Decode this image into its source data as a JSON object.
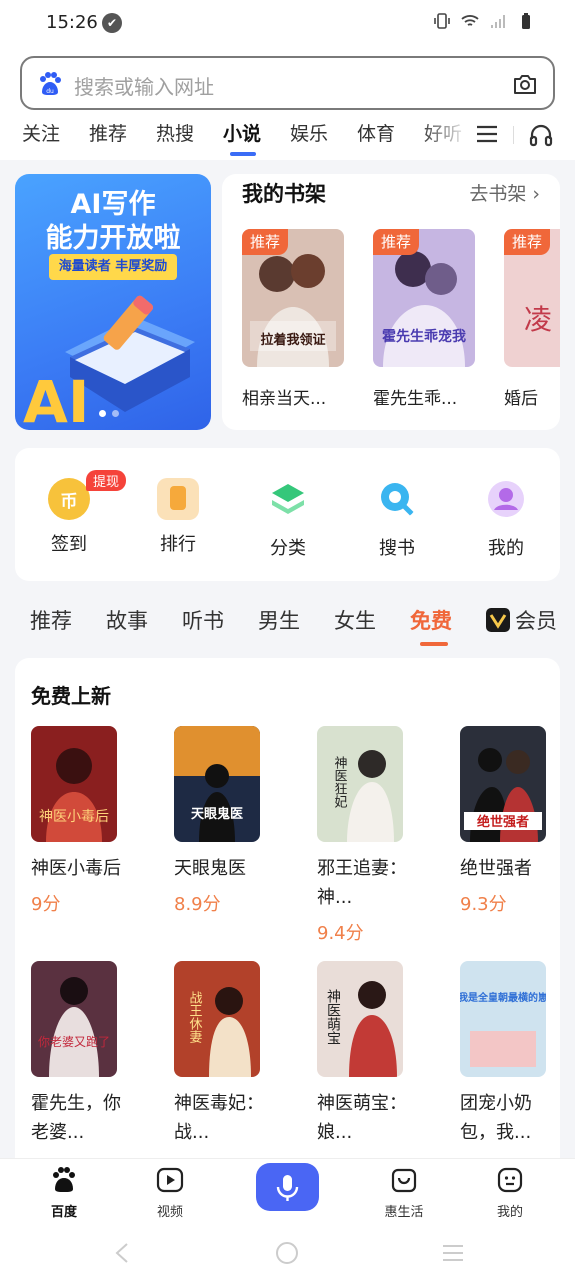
{
  "status": {
    "time": "15:26",
    "check_glyph": "✔"
  },
  "search": {
    "placeholder": "搜索或输入网址"
  },
  "tabs": [
    {
      "label": "关注"
    },
    {
      "label": "推荐"
    },
    {
      "label": "热搜"
    },
    {
      "label": "小说",
      "active": true
    },
    {
      "label": "娱乐"
    },
    {
      "label": "体育"
    },
    {
      "label": "好听"
    }
  ],
  "banner": {
    "title_line1": "AI写作",
    "title_line2": "能力开放啦",
    "subtitle": "海量读者 丰厚奖励",
    "art_text": "AI"
  },
  "shelf": {
    "title": "我的书架",
    "link": "去书架",
    "books": [
      {
        "badge": "推荐",
        "title": "相亲当天...",
        "cover_text": "拉着我领证",
        "cover_color": "#c9a89a"
      },
      {
        "badge": "推荐",
        "title": "霍先生乖...",
        "cover_text": "霍先生乖宠我",
        "cover_color": "#b9a6d8"
      },
      {
        "badge": "推荐",
        "title": "婚后",
        "cover_text": "凌",
        "cover_color": "#e6b7b7"
      }
    ]
  },
  "quick": [
    {
      "label": "签到",
      "badge": "提现",
      "icon": "coin-icon",
      "color": "#f7c23b"
    },
    {
      "label": "排行",
      "icon": "ranking-icon",
      "color": "#f6a93b"
    },
    {
      "label": "分类",
      "icon": "category-icon",
      "color": "#35c77a"
    },
    {
      "label": "搜书",
      "icon": "search-book-icon",
      "color": "#3ab5f0"
    },
    {
      "label": "我的",
      "icon": "profile-icon",
      "color": "#b36ae8"
    }
  ],
  "categories": [
    {
      "label": "推荐"
    },
    {
      "label": "故事"
    },
    {
      "label": "听书"
    },
    {
      "label": "男生"
    },
    {
      "label": "女生"
    },
    {
      "label": "免费",
      "active": true
    },
    {
      "label": "会员"
    }
  ],
  "free": {
    "title": "免费上新",
    "books": [
      {
        "name": "神医小毒后",
        "score": "9分",
        "cover_text": "神医小毒后",
        "cover_color": "#8a1f1f"
      },
      {
        "name": "天眼鬼医",
        "score": "8.9分",
        "cover_text": "天眼鬼医",
        "cover_color": "#1e2a44"
      },
      {
        "name": "邪王追妻：神...",
        "score": "9.4分",
        "cover_text": "神医狂妃",
        "cover_color": "#d8e1cf"
      },
      {
        "name": "绝世强者",
        "score": "9.3分",
        "cover_text": "绝世强者",
        "cover_color": "#2b2f3a"
      },
      {
        "name": "霍先生，你老婆...",
        "score": "",
        "cover_text": "你老婆又跑了",
        "cover_color": "#5a3140"
      },
      {
        "name": "神医毒妃：战...",
        "score": "",
        "cover_text": "战王休妻",
        "cover_color": "#b2412a"
      },
      {
        "name": "神医萌宝：娘...",
        "score": "",
        "cover_text": "神医萌宝",
        "cover_color": "#e9ddd8"
      },
      {
        "name": "团宠小奶包，我...",
        "score": "",
        "cover_text": "我是全皇朝最横的崽",
        "cover_color": "#cfe3ef"
      }
    ]
  },
  "bottomnav": [
    {
      "label": "百度",
      "icon": "baidu-paw-icon",
      "active": true
    },
    {
      "label": "视频",
      "icon": "video-play-icon"
    },
    {
      "label": "",
      "icon": "microphone-icon"
    },
    {
      "label": "惠生活",
      "icon": "bag-icon"
    },
    {
      "label": "我的",
      "icon": "smiley-profile-icon"
    }
  ],
  "colors": {
    "accent_blue": "#3a6cf6",
    "accent_orange": "#f0673a",
    "score_orange": "#f0804a"
  }
}
